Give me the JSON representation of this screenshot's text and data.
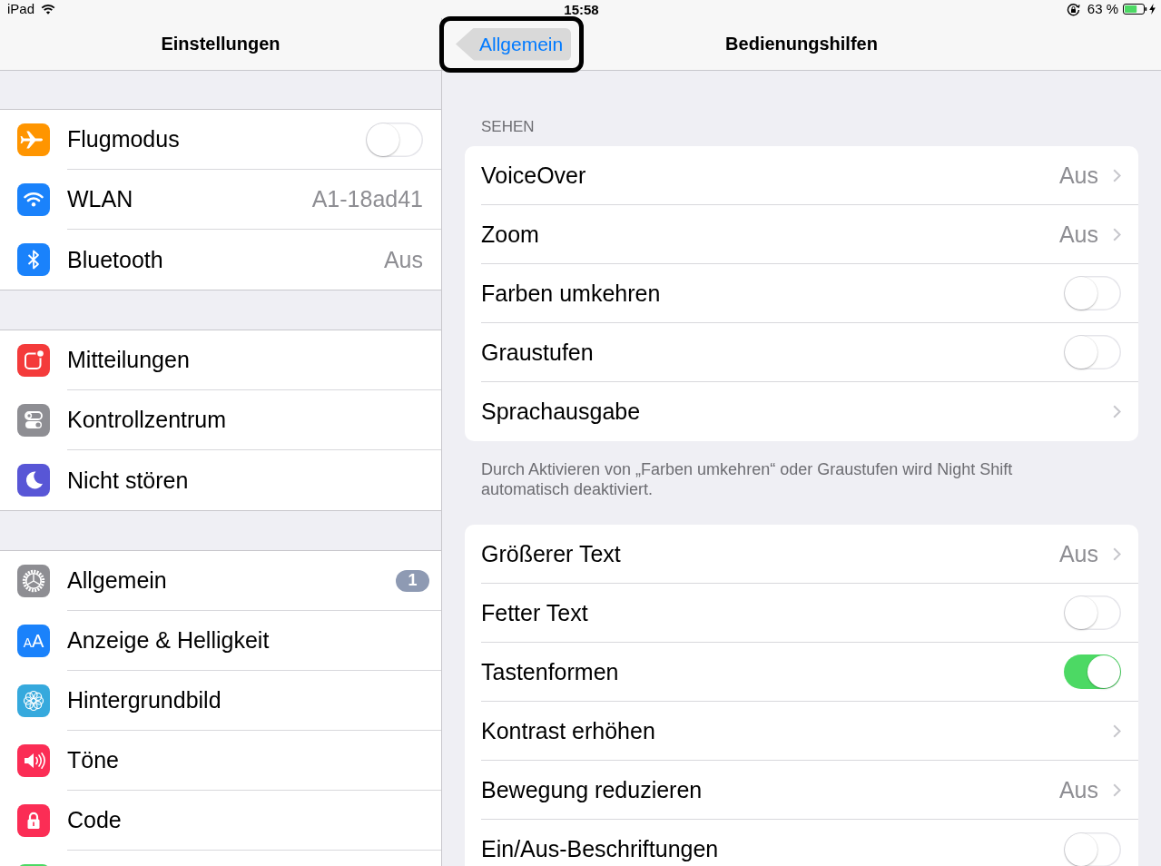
{
  "status_bar": {
    "device": "iPad",
    "time": "15:58",
    "battery": "63 %"
  },
  "sidebar": {
    "title": "Einstellungen",
    "groups": [
      {
        "items": [
          {
            "label": "Flugmodus",
            "kind": "toggle",
            "on": false,
            "color": "#ff9500",
            "selected": false
          },
          {
            "label": "WLAN",
            "kind": "value",
            "value": "A1-18ad41",
            "color": "#1a82fb",
            "selected": false
          },
          {
            "label": "Bluetooth",
            "kind": "value",
            "value": "Aus",
            "color": "#1a82fb",
            "selected": false
          }
        ]
      },
      {
        "items": [
          {
            "label": "Mitteilungen",
            "kind": "plain",
            "color": "#f43b3b",
            "selected": false
          },
          {
            "label": "Kontrollzentrum",
            "kind": "plain",
            "color": "#8e8e93",
            "selected": false
          },
          {
            "label": "Nicht stören",
            "kind": "plain",
            "color": "#5856d6",
            "selected": false
          }
        ]
      },
      {
        "items": [
          {
            "label": "Allgemein",
            "kind": "badge",
            "badge": "1",
            "color": "#8e8e93",
            "selected": false
          },
          {
            "label": "Anzeige & Helligkeit",
            "kind": "plain",
            "icon_text": "AA",
            "color": "#1a82fb",
            "selected": false
          },
          {
            "label": "Hintergrundbild",
            "kind": "plain",
            "color": "#36a9dd",
            "selected": false
          },
          {
            "label": "Töne",
            "kind": "plain",
            "color": "#fb2d55",
            "selected": false
          },
          {
            "label": "Code",
            "kind": "plain",
            "color": "#fb2d55",
            "selected": false
          },
          {
            "kind": "plain",
            "color": "#4cd964",
            "selected": false
          }
        ]
      }
    ]
  },
  "detail": {
    "back_button": {
      "label": "Allgemein",
      "highlighted": true
    },
    "title": "Bedienungshilfen",
    "sections": [
      {
        "header": "SEHEN",
        "rows": [
          {
            "label": "VoiceOver",
            "kind": "value",
            "value": "Aus"
          },
          {
            "label": "Zoom",
            "kind": "value",
            "value": "Aus"
          },
          {
            "label": "Farben umkehren",
            "kind": "toggle",
            "on": false
          },
          {
            "label": "Graustufen",
            "kind": "toggle",
            "on": false
          },
          {
            "label": "Sprachausgabe",
            "kind": "link"
          }
        ],
        "footer": "Durch Aktivieren von „Farben umkehren“ oder Graustufen wird Night Shift automatisch deaktiviert."
      },
      {
        "rows": [
          {
            "label": "Größerer Text",
            "kind": "value",
            "value": "Aus"
          },
          {
            "label": "Fetter Text",
            "kind": "toggle",
            "on": false
          },
          {
            "label": "Tastenformen",
            "kind": "toggle",
            "on": true
          },
          {
            "label": "Kontrast erhöhen",
            "kind": "link"
          },
          {
            "label": "Bewegung reduzieren",
            "kind": "value",
            "value": "Aus"
          },
          {
            "label": "Ein/Aus-Beschriftungen",
            "kind": "toggle",
            "on": false
          }
        ]
      }
    ]
  }
}
